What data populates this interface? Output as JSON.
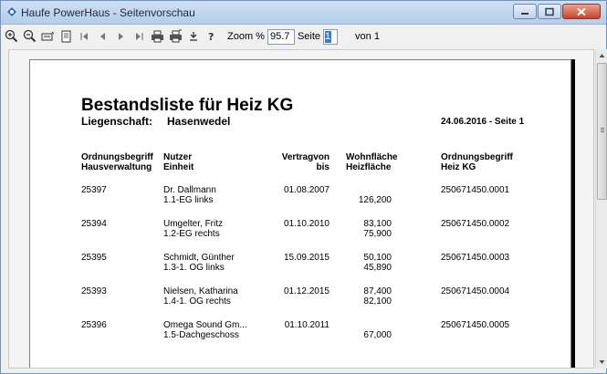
{
  "window": {
    "title": "Haufe PowerHaus - Seitenvorschau"
  },
  "toolbar": {
    "zoom_label": "Zoom %",
    "zoom_value": "95.7",
    "page_label": "Seite",
    "page_value": "1",
    "of_label": "von 1"
  },
  "report": {
    "title": "Bestandsliste für Heiz KG",
    "property_label": "Liegenschaft:",
    "property_value": "Hasenwedel",
    "date_page": "24.06.2016 - Seite 1",
    "headers": {
      "col1": [
        "Ordnungsbegriff",
        "Hausverwaltung"
      ],
      "col2": [
        "Nutzer",
        "Einheit"
      ],
      "col3": [
        "Vertragvon",
        "bis"
      ],
      "col4": [
        "Wohnfläche",
        "Heizfläche"
      ],
      "col5": [
        "Ordnungsbegriff",
        "Heiz KG"
      ]
    },
    "rows": [
      {
        "id": "25397",
        "name": "Dr. Dallmann",
        "unit": "1.1-EG links",
        "from": "01.08.2007",
        "wohn": "",
        "heiz": "126,200",
        "ref": "250671450.0001"
      },
      {
        "id": "25394",
        "name": "Umgelter, Fritz",
        "unit": "1.2-EG rechts",
        "from": "01.10.2010",
        "wohn": "83,100",
        "heiz": "75,900",
        "ref": "250671450.0002"
      },
      {
        "id": "25395",
        "name": "Schmidt, Günther",
        "unit": "1.3-1. OG links",
        "from": "15.09.2015",
        "wohn": "50,100",
        "heiz": "45,890",
        "ref": "250671450.0003"
      },
      {
        "id": "25393",
        "name": "Nielsen, Katharina",
        "unit": "1.4-1. OG rechts",
        "from": "01.12.2015",
        "wohn": "87,400",
        "heiz": "82,100",
        "ref": "250671450.0004"
      },
      {
        "id": "25396",
        "name": "Omega Sound Gm...",
        "unit": "1.5-Dachgeschoss",
        "from": "01.10.2011",
        "wohn": "",
        "heiz": "67,000",
        "ref": "250671450.0005"
      }
    ]
  },
  "colors": {
    "accent": "#3b7bd0",
    "close": "#c8452a"
  }
}
